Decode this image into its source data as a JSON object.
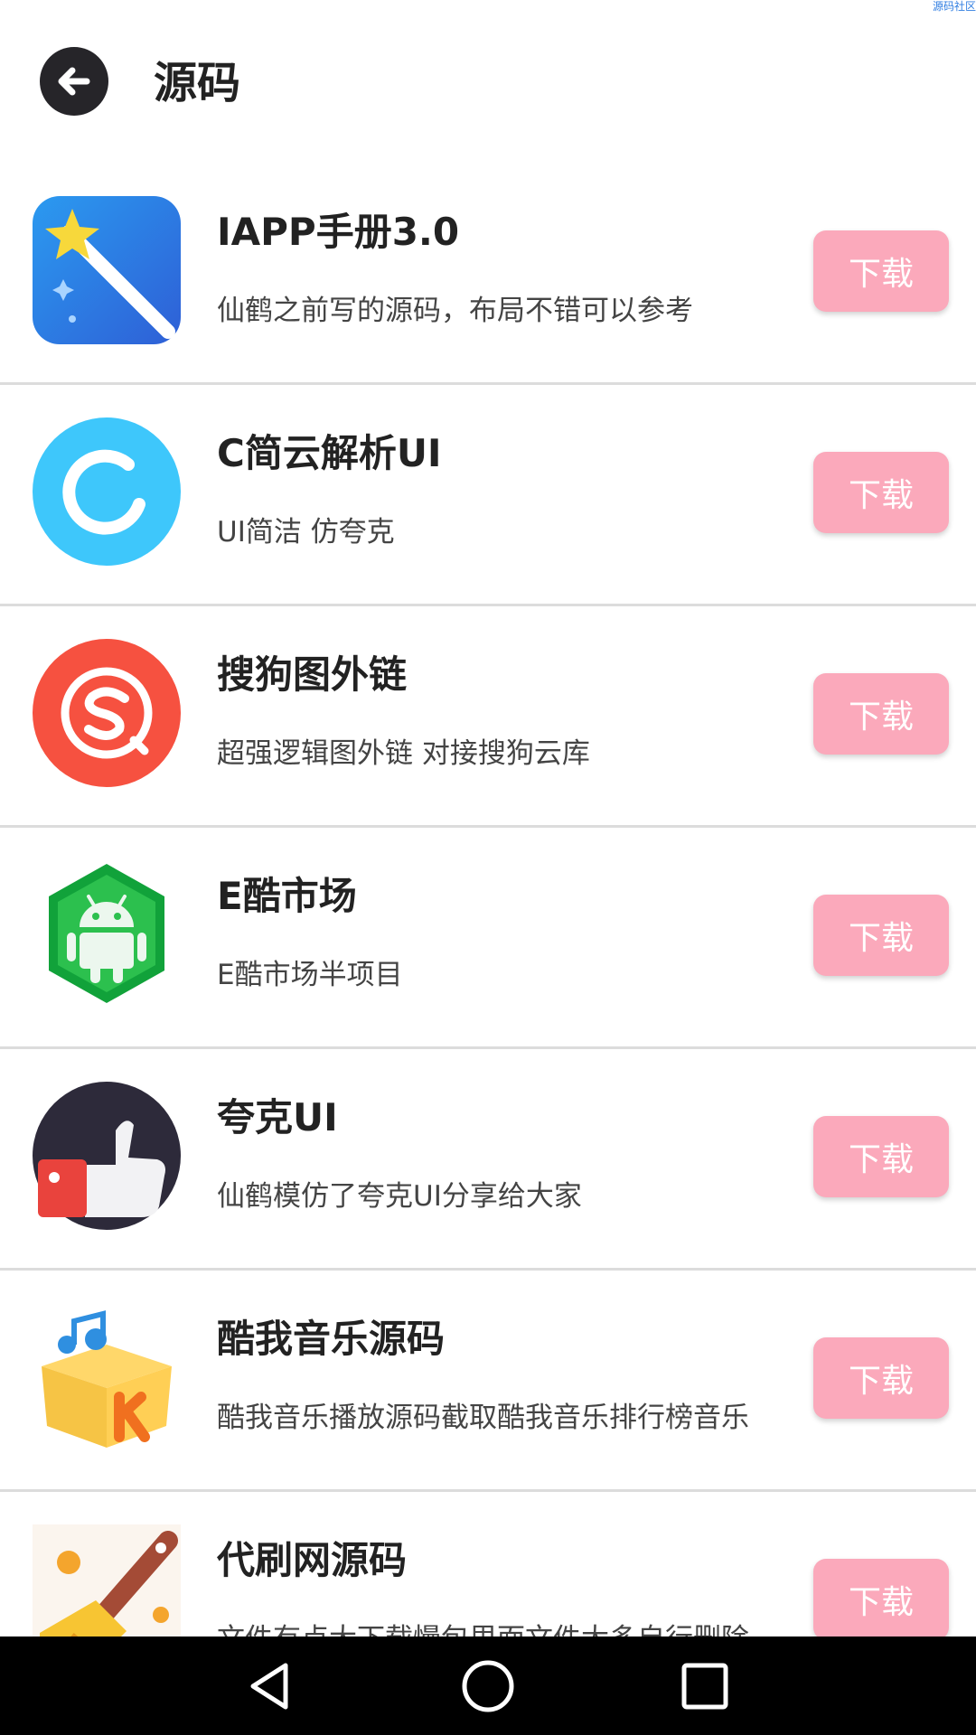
{
  "watermark": "源码社区",
  "header": {
    "back_icon": "arrow-left-icon",
    "title": "源码"
  },
  "colors": {
    "download_button": "#fba9bb",
    "divider": "#dcdcdc",
    "back_button": "#262529"
  },
  "items": [
    {
      "title": "IAPP手册3.0",
      "desc": "仙鹤之前写的源码，布局不错可以参考",
      "button": "下载",
      "icon": "magic-wand-icon"
    },
    {
      "title": "C简云解析UI",
      "desc": "UI简洁 仿夸克",
      "button": "下载",
      "icon": "ring-logo-icon"
    },
    {
      "title": "搜狗图外链",
      "desc": "超强逻辑图外链 对接搜狗云库",
      "button": "下载",
      "icon": "sogou-logo-icon"
    },
    {
      "title": "E酷市场",
      "desc": "E酷市场半项目",
      "button": "下载",
      "icon": "android-hexagon-icon"
    },
    {
      "title": "夸克UI",
      "desc": "仙鹤模仿了夸克UI分享给大家",
      "button": "下载",
      "icon": "thumbs-up-icon"
    },
    {
      "title": "酷我音乐源码",
      "desc": "酷我音乐播放源码截取酷我音乐排行榜音乐",
      "button": "下载",
      "icon": "kuwo-box-icon"
    },
    {
      "title": "代刷网源码",
      "desc": "文件有点大下载慢包里面文件太多自行删除",
      "button": "下载",
      "icon": "paint-brush-icon"
    }
  ],
  "navbar": {
    "back": "triangle-back-icon",
    "home": "circle-home-icon",
    "recents": "square-recents-icon"
  }
}
